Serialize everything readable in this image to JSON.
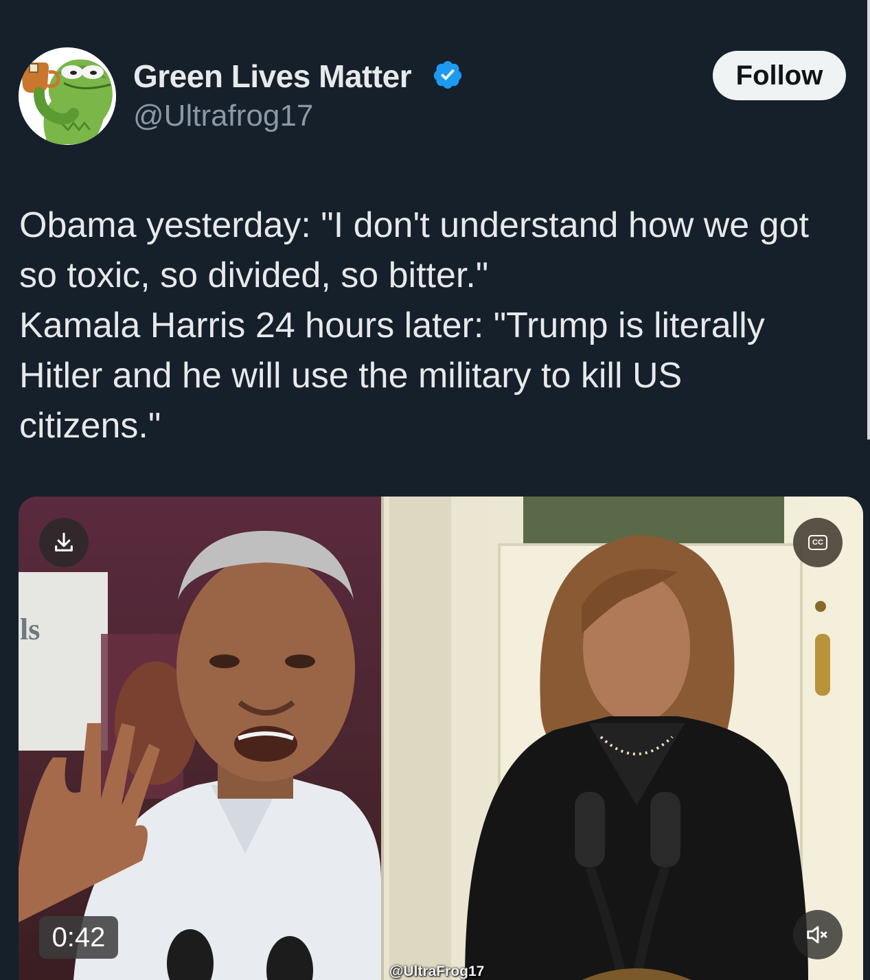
{
  "user": {
    "display_name": "Green Lives Matter",
    "handle": "@Ultrafrog17",
    "avatar_icon": "kermit-sipping-tea-avatar",
    "verified": true,
    "verified_badge_color": "#1d9bf0"
  },
  "follow_button": {
    "label": "Follow"
  },
  "tweet": {
    "lines": [
      "Obama yesterday: \"I don't understand how we got",
      "so toxic, so divided, so bitter.\"",
      "Kamala Harris 24 hours later: \"Trump is literally",
      "Hitler and he will use the military to kill US",
      "citizens.\""
    ]
  },
  "media": {
    "duration": "0:42",
    "watermark": "@UltraFrog17",
    "sign_text": "ls",
    "cc_label": "CC",
    "download_icon": "download-icon",
    "cc_icon": "closed-captions-icon",
    "mute_icon": "speaker-muted-icon"
  },
  "colors": {
    "background": "#15202b",
    "text_primary": "#e7e9ea",
    "text_secondary": "#8b98a5",
    "follow_bg": "#eff3f4"
  }
}
